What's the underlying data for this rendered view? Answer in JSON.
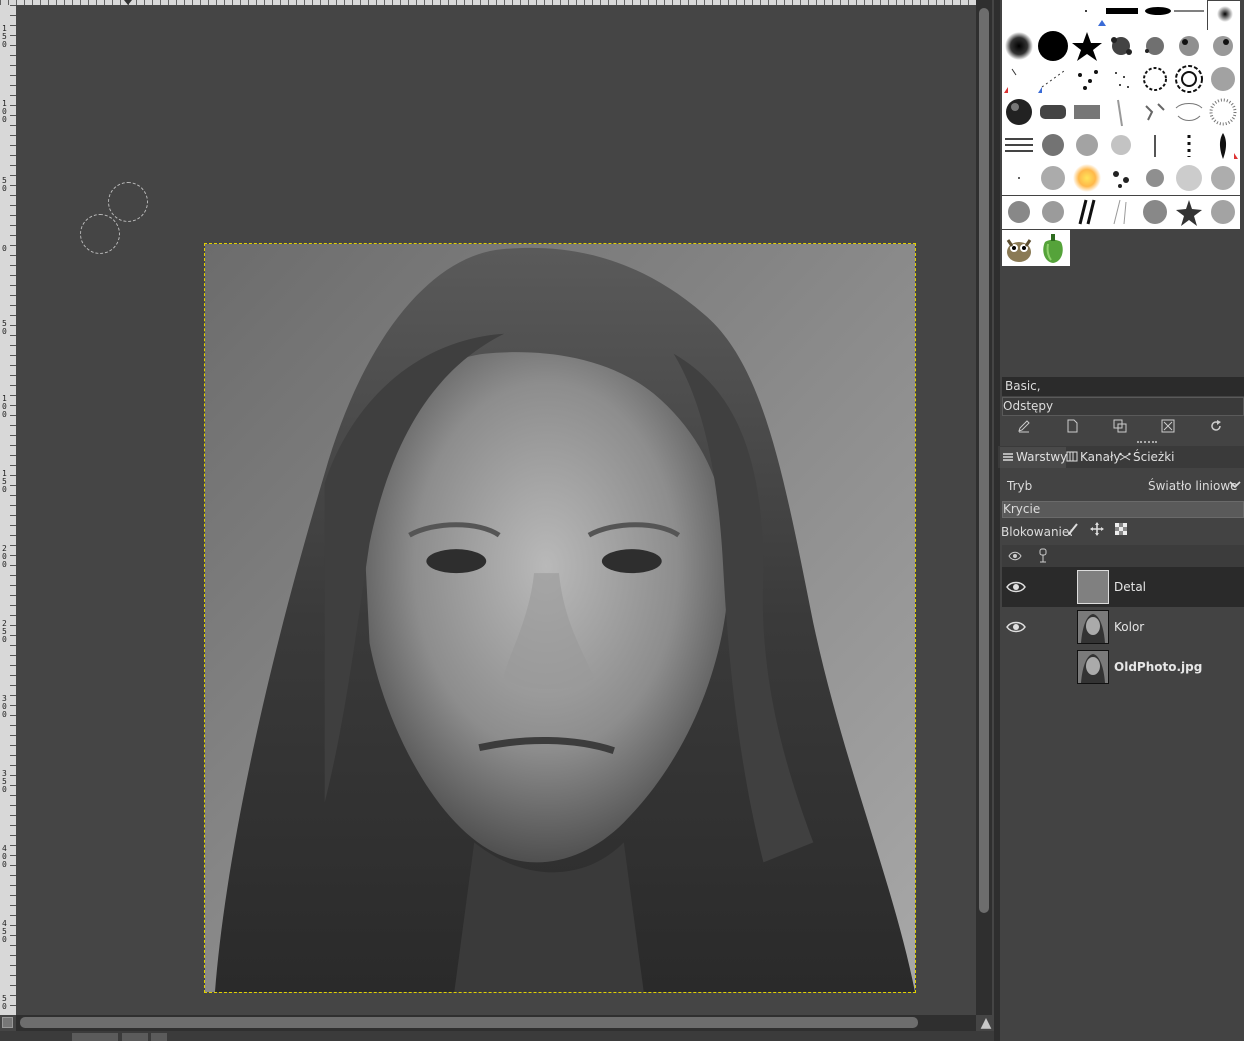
{
  "rulers": {
    "vertical_labels": [
      "150",
      "100",
      "50",
      "0",
      "50",
      "100",
      "150",
      "200",
      "250",
      "300",
      "350",
      "400",
      "450",
      "50"
    ]
  },
  "canvas": {
    "image_name": "OldPhoto.jpg"
  },
  "brushes": {
    "name": "Basic,",
    "spacing_label": "Odstępy",
    "actions": [
      "edit-brush-icon",
      "new-brush-icon",
      "duplicate-brush-icon",
      "delete-brush-icon",
      "refresh-brushes-icon"
    ]
  },
  "layers_dock": {
    "tabs": [
      {
        "label": "Warstwy",
        "icon": "layers-icon",
        "active": true
      },
      {
        "label": "Kanały",
        "icon": "channels-icon",
        "active": false
      },
      {
        "label": "Ścieżki",
        "icon": "paths-icon",
        "active": false
      }
    ],
    "mode_label": "Tryb",
    "mode_value": "Światło liniowe",
    "opacity_label": "Krycie",
    "lock_label": "Blokowanie:",
    "lock_icons": [
      "lock-pixels-icon",
      "lock-position-icon",
      "lock-alpha-icon"
    ],
    "layers": [
      {
        "name": "Detal",
        "visible": true,
        "selected": true,
        "thumb": "gray"
      },
      {
        "name": "Kolor",
        "visible": true,
        "selected": false,
        "thumb": "portrait"
      },
      {
        "name": "OldPhoto.jpg",
        "visible": false,
        "selected": false,
        "thumb": "portrait",
        "bold": true
      }
    ]
  },
  "colors": {
    "canvas_bg": "#454545",
    "selection_border": "#e0d000",
    "dock_bg": "#434343"
  }
}
